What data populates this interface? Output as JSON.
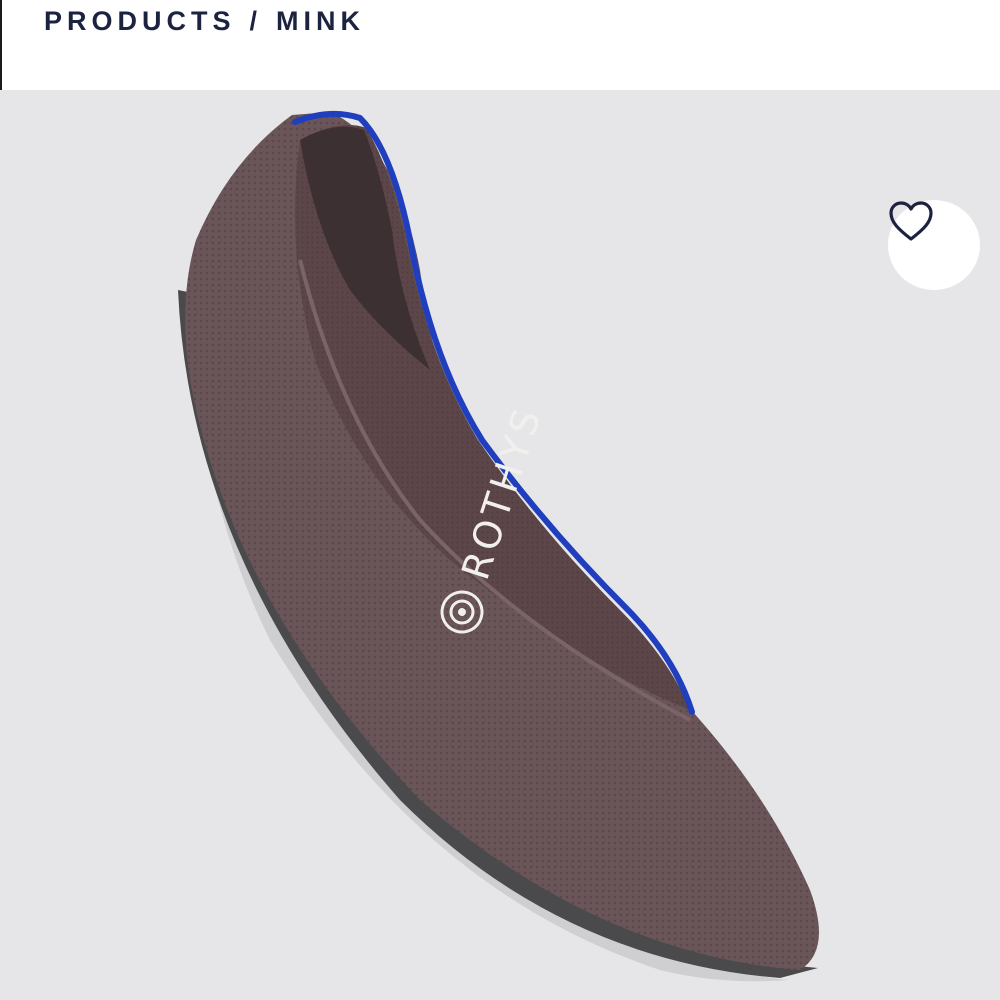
{
  "breadcrumb": {
    "section": "PRODUCTS",
    "separator": "/",
    "current": "MINK"
  },
  "favorite_button": {
    "icon": "heart-outline-icon"
  },
  "product_image": {
    "brand_mark": "ROTHYS",
    "colors": {
      "knit": "#6a5559",
      "lining": "#5a4548",
      "trim": "#1f3fbf",
      "sole": "#4a4a4c",
      "background": "#e6e6e8"
    }
  }
}
